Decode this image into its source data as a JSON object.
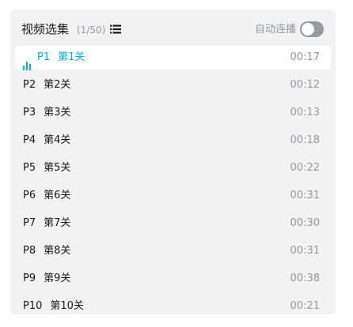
{
  "header": {
    "title": "视频选集",
    "count": "(1/50)",
    "autoplay_label": "自动连播",
    "autoplay_on": false
  },
  "episodes": [
    {
      "part": "P1",
      "name": "第1关",
      "duration": "00:17",
      "active": true
    },
    {
      "part": "P2",
      "name": "第2关",
      "duration": "00:12",
      "active": false
    },
    {
      "part": "P3",
      "name": "第3关",
      "duration": "00:13",
      "active": false
    },
    {
      "part": "P4",
      "name": "第4关",
      "duration": "00:18",
      "active": false
    },
    {
      "part": "P5",
      "name": "第5关",
      "duration": "00:22",
      "active": false
    },
    {
      "part": "P6",
      "name": "第6关",
      "duration": "00:31",
      "active": false
    },
    {
      "part": "P7",
      "name": "第7关",
      "duration": "00:30",
      "active": false
    },
    {
      "part": "P8",
      "name": "第8关",
      "duration": "00:31",
      "active": false
    },
    {
      "part": "P9",
      "name": "第9关",
      "duration": "00:38",
      "active": false
    },
    {
      "part": "P10",
      "name": "第10关",
      "duration": "00:21",
      "active": false
    }
  ],
  "colors": {
    "accent": "#00aeec",
    "muted": "#9499a0",
    "text": "#18191c",
    "panel_bg": "#f1f2f3"
  },
  "icons": {
    "list_view": "list-icon",
    "playing": "playing-bars-icon"
  }
}
